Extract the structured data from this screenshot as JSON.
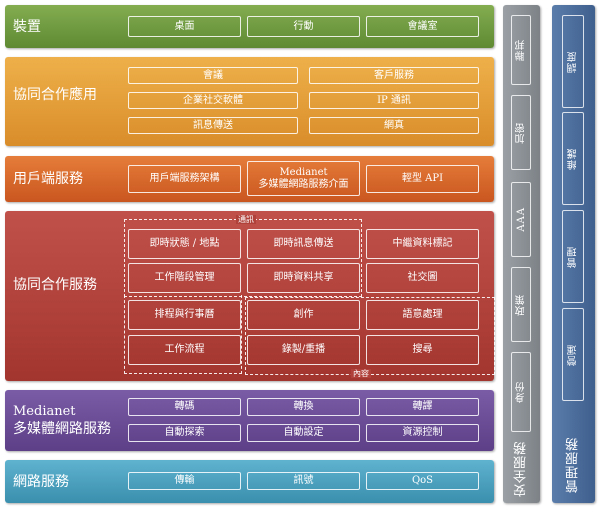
{
  "devices": {
    "title": "裝置",
    "items": [
      "桌面",
      "行動",
      "會議室"
    ]
  },
  "collab_apps": {
    "title": "協同合作應用",
    "items": [
      "會議",
      "客戶服務",
      "企業社交軟體",
      "IP 通訊",
      "訊息傳送",
      "網真"
    ]
  },
  "client": {
    "title": "用戶端服務",
    "items": [
      "用戶端服務架構",
      "Medianet",
      "多媒體網路服務介面",
      "輕型 API"
    ]
  },
  "collab_services": {
    "title": "協同合作服務",
    "group_comm": "通訊",
    "group_content": "內容",
    "items": [
      "即時狀態 / 地點",
      "即時訊息傳送",
      "中繼資料標記",
      "工作階段管理",
      "即時資料共享",
      "社交圖",
      "排程與行事曆",
      "創作",
      "語意處理",
      "工作流程",
      "錄製/重播",
      "搜尋"
    ]
  },
  "medianet": {
    "title_en": "Medianet",
    "title_zh": "多媒體網路服務",
    "items": [
      "轉碼",
      "轉換",
      "轉譯",
      "自動探索",
      "自動設定",
      "資源控制"
    ]
  },
  "network": {
    "title": "網路服務",
    "items": [
      "傳輸",
      "訊號",
      "QoS"
    ]
  },
  "security": {
    "title": "安全服務",
    "items": [
      "聯邦",
      "加密",
      "AAA",
      "政策",
      "身份"
    ]
  },
  "management": {
    "title": "管理服務",
    "items": [
      "調度",
      "維護",
      "管理",
      "營運"
    ]
  },
  "colors": {
    "devices": "#6f9a3e",
    "apps": "#e19b35",
    "client": "#d8692b",
    "collab": "#b0403a",
    "medianet": "#6b4c95",
    "network": "#4ba1bf",
    "security": "#8c9196",
    "management": "#4b6d99"
  }
}
